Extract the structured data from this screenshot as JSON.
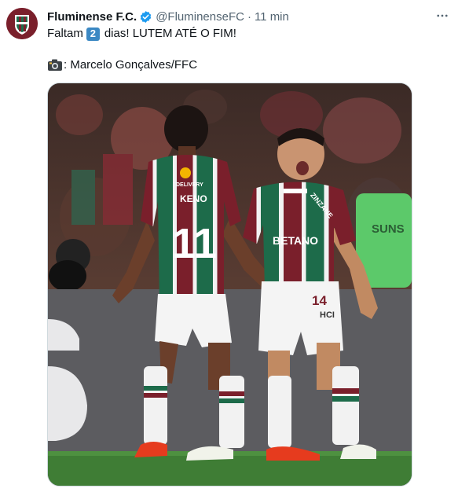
{
  "account": {
    "name": "Fluminense F.C.",
    "handle": "@FluminenseFC",
    "separator": "·",
    "time": "11 min"
  },
  "tweet": {
    "text_before": "Faltam",
    "keycap": "2",
    "text_after": "dias! LUTEM ATÉ O FIM!",
    "credit": ": Marcelo Gonçalves/FFC"
  },
  "photo": {
    "player_left_name": "KENO",
    "player_left_number": "11",
    "player_right_number": "14",
    "sponsor": "BETANO",
    "sponsor_hci": "HCI",
    "sleeve_text": "ZINZANE",
    "banner_text": "SUNS",
    "delivery_text": "DELIVERY"
  },
  "colors": {
    "club_maroon": "#7a1f2b",
    "club_green": "#1d6b4a",
    "verified_blue": "#1d9bf0",
    "muted_text": "#536471"
  },
  "icons": {
    "verified": "verified-badge-icon",
    "more": "more-options-icon",
    "camera": "camera-icon"
  }
}
